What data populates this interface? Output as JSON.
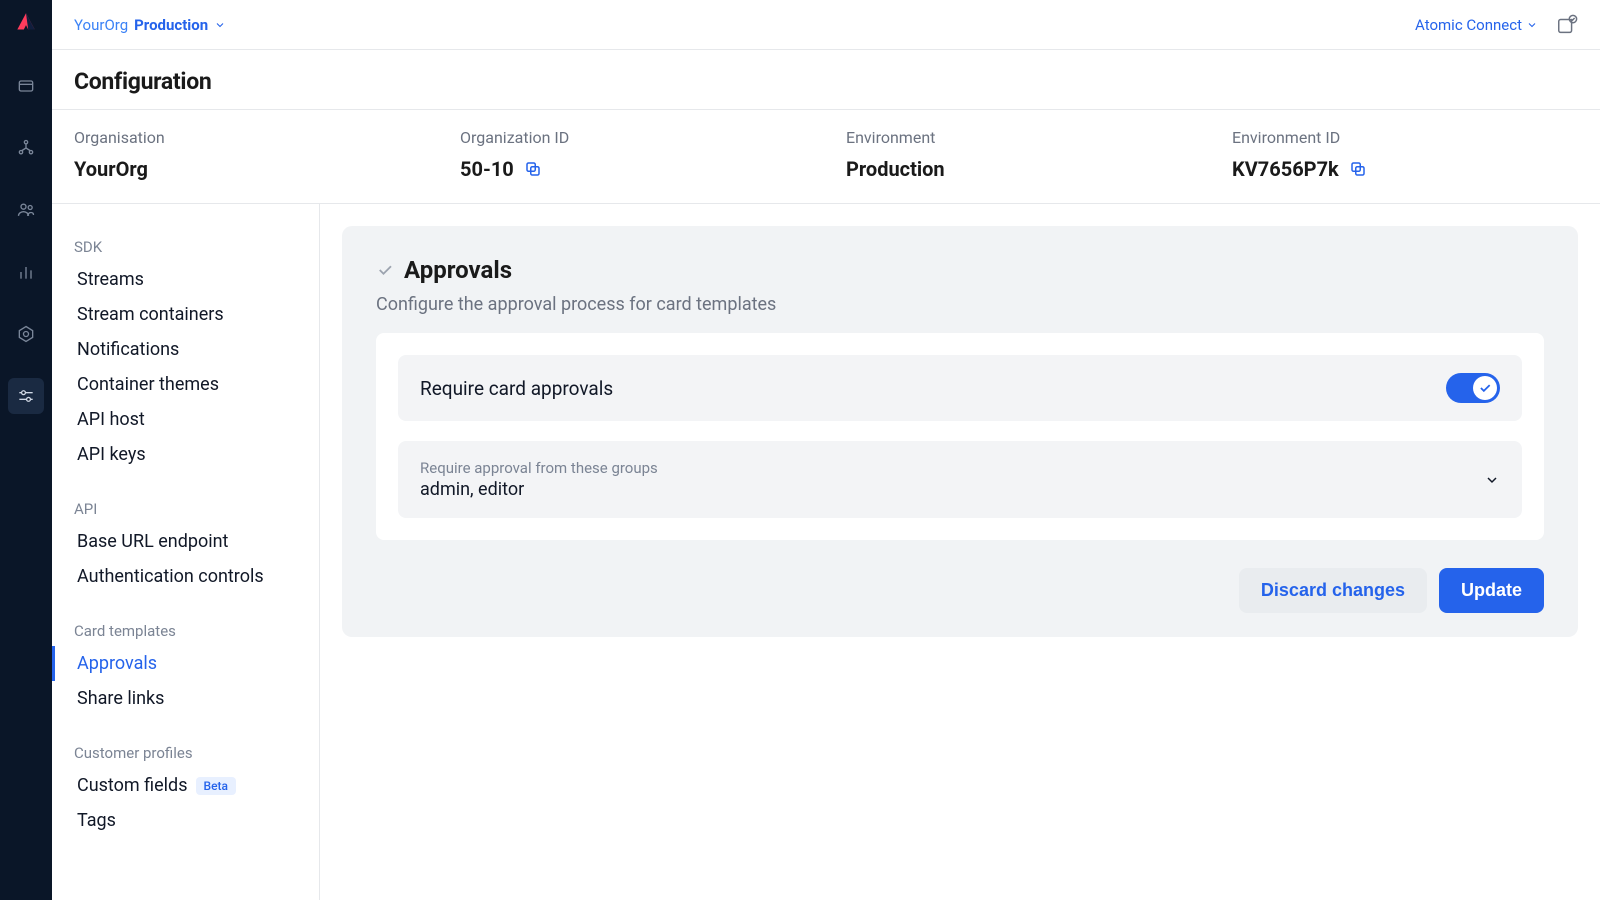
{
  "breadcrumb": {
    "org": "YourOrg",
    "env": "Production"
  },
  "top_right": {
    "connect_label": "Atomic Connect"
  },
  "page": {
    "title": "Configuration"
  },
  "info": {
    "org_label": "Organisation",
    "org_value": "YourOrg",
    "org_id_label": "Organization ID",
    "org_id_value": "50-10",
    "env_label": "Environment",
    "env_value": "Production",
    "env_id_label": "Environment ID",
    "env_id_value": "KV7656P7k"
  },
  "sidebar": {
    "groups": [
      {
        "label": "SDK",
        "items": [
          {
            "label": "Streams"
          },
          {
            "label": "Stream containers"
          },
          {
            "label": "Notifications"
          },
          {
            "label": "Container themes"
          },
          {
            "label": "API host"
          },
          {
            "label": "API keys"
          }
        ]
      },
      {
        "label": "API",
        "items": [
          {
            "label": "Base URL endpoint"
          },
          {
            "label": "Authentication controls"
          }
        ]
      },
      {
        "label": "Card templates",
        "items": [
          {
            "label": "Approvals",
            "active": true
          },
          {
            "label": "Share links"
          }
        ]
      },
      {
        "label": "Customer profiles",
        "items": [
          {
            "label": "Custom fields",
            "badge": "Beta"
          },
          {
            "label": "Tags"
          }
        ]
      }
    ]
  },
  "panel": {
    "title": "Approvals",
    "subtitle": "Configure the approval process for card templates",
    "require_label": "Require card approvals",
    "groups_label": "Require approval from these groups",
    "groups_value": "admin, editor",
    "discard_label": "Discard changes",
    "update_label": "Update"
  }
}
